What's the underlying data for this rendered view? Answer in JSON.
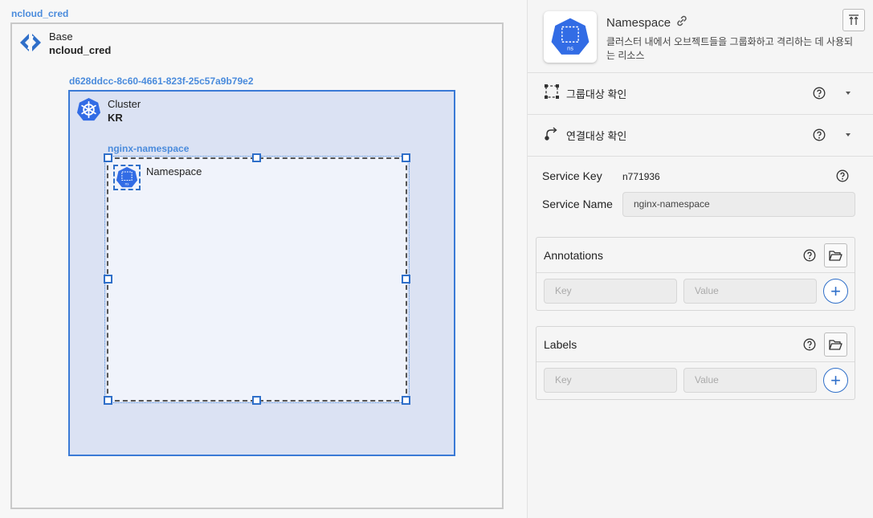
{
  "canvas": {
    "base_frame_label": "ncloud_cred",
    "base_node": {
      "title": "Base",
      "name": "ncloud_cred"
    },
    "cluster_frame_label": "d628ddcc-8c60-4661-823f-25c57a9b79e2",
    "cluster_node": {
      "title": "Cluster",
      "name": "KR"
    },
    "namespace_frame_label": "nginx-namespace",
    "namespace_node": {
      "title": "Namespace",
      "icon_text": "ns"
    }
  },
  "panel": {
    "header": {
      "title": "Namespace",
      "description": "클러스터 내에서 오브젝트들을 그룹화하고 격리하는 데 사용되는 리소스",
      "icon_text": "ns"
    },
    "group_check_label": "그룹대상 확인",
    "connect_check_label": "연결대상 확인",
    "service_key_label": "Service Key",
    "service_key_value": "n771936",
    "service_name_label": "Service Name",
    "service_name_value": "nginx-namespace",
    "annotations": {
      "title": "Annotations",
      "key_placeholder": "Key",
      "value_placeholder": "Value",
      "add_symbol": "+"
    },
    "labels": {
      "title": "Labels",
      "key_placeholder": "Key",
      "value_placeholder": "Value",
      "add_symbol": "+"
    }
  },
  "colors": {
    "accent": "#2f6fc9",
    "frame_label": "#4a8bdc",
    "cluster_fill": "#dbe2f3",
    "k8s_blue": "#326ce5"
  }
}
